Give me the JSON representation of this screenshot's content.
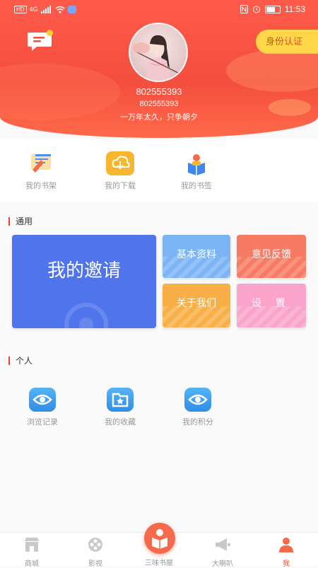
{
  "status_bar": {
    "left_icons": [
      "hd-icon",
      "signal-icon",
      "wifi-icon",
      "app-icon"
    ],
    "hd_label": "HD",
    "net_label": "4G",
    "time": "11:53"
  },
  "header": {
    "message_icon": "message-icon",
    "verify_button": "身份认证",
    "user_id": "802555393",
    "user_id_small": "802555393",
    "motto": "一万年太久，只争朝夕"
  },
  "quick_actions": [
    {
      "label": "我的书架",
      "icon": "bookshelf-icon"
    },
    {
      "label": "我的下载",
      "icon": "cloud-download-icon"
    },
    {
      "label": "我的书签",
      "icon": "bookmark-reader-icon"
    }
  ],
  "general": {
    "title": "通用",
    "invite": "我的邀请",
    "basic_info": "基本资料",
    "feedback": "意见反馈",
    "about": "关于我们",
    "settings": "设 置"
  },
  "personal": {
    "title": "个人",
    "items": [
      {
        "label": "浏览记录",
        "icon": "eye-icon"
      },
      {
        "label": "我的收藏",
        "icon": "star-folder-icon"
      },
      {
        "label": "我的积分",
        "icon": "eye-points-icon"
      }
    ]
  },
  "tabs": [
    {
      "label": "商城",
      "icon": "store-icon"
    },
    {
      "label": "影视",
      "icon": "film-icon"
    },
    {
      "label": "三味书屋",
      "icon": "reader-icon"
    },
    {
      "label": "大喇叭",
      "icon": "megaphone-icon"
    },
    {
      "label": "我",
      "icon": "person-icon"
    }
  ],
  "colors": {
    "brand_red": "#f44e3e",
    "accent_yellow": "#ffd84a",
    "invite_blue": "#4f74ec",
    "basic_blue": "#7db4f6",
    "feedback_orange": "#f77b64",
    "about_yellow": "#f8b046",
    "settings_pink": "#fba4cb"
  }
}
